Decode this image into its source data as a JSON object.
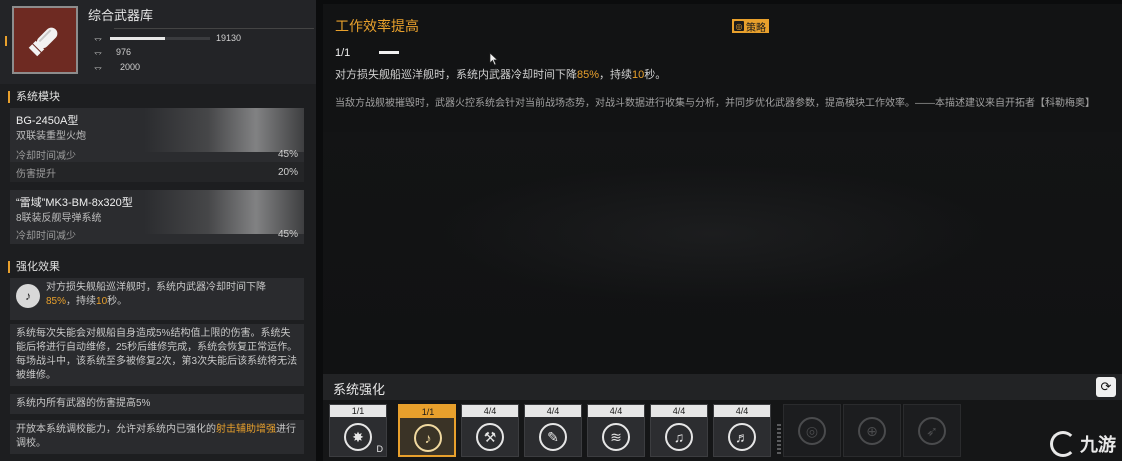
{
  "weapon": {
    "name": "综合武器库",
    "stats": [
      {
        "icon": "damage-icon",
        "value": "19130",
        "fill": 0.55
      },
      {
        "icon": "armor-icon",
        "value": "976",
        "fill": 0.03
      },
      {
        "icon": "speed-icon",
        "value": "2000",
        "fill": 0.05
      }
    ]
  },
  "modules_section": {
    "title": "系统模块",
    "modules": [
      {
        "name": "BG-2450A型",
        "subtitle": "双联装重型火炮",
        "rows": [
          {
            "label": "冷却时间减少",
            "value": "45%"
          },
          {
            "label": "伤害提升",
            "value": "20%"
          }
        ]
      },
      {
        "name": "“雷域”MK3-BM-8x320型",
        "subtitle": "8联装反舰导弹系统",
        "rows": [
          {
            "label": "冷却时间减少",
            "value": "45%"
          }
        ]
      }
    ]
  },
  "effects_section": {
    "title": "强化效果",
    "effect1_a": "对方损失舰船巡洋舰时，系统内武器冷却时间下降",
    "effect1_hl": "85%",
    "effect1_b": "，持续",
    "effect1_hl2": "10",
    "effect1_c": "秒。",
    "effect2": "系统每次失能会对舰船自身造成5%结构值上限的伤害。系统失能后将进行自动维修，25秒后维修完成，系统会恢复正常运作。每场战斗中，该系统至多被修复2次，第3次失能后该系统将无法被维修。",
    "effect3": "系统内所有武器的伤害提高5%",
    "effect4_a": "开放本系统调校能力，允许对系统内已强化的",
    "effect4_hl": "射击辅助增强",
    "effect4_b": "进行调校。"
  },
  "detail": {
    "title": "工作效率提高",
    "tag": "策略",
    "level": "1/1",
    "desc_a": "对方损失舰船巡洋舰时，系统内武器冷却时间下降",
    "desc_hl": "85%",
    "desc_b": "，持续",
    "desc_hl2": "10",
    "desc_c": "秒。",
    "flavor": "当敌方战舰被摧毁时，武器火控系统会针对当前战场态势，对战斗数据进行收集与分析，并同步优化武器参数，提高模块工作效率。——本描述建议来自开拓者【科勒梅奥】"
  },
  "enhancement": {
    "title": "系统强化",
    "slots": [
      {
        "count": "1/1",
        "icon": "efficiency-icon",
        "state": "normal",
        "suffix": "D"
      },
      {
        "count": "1/1",
        "icon": "guitar-upgrade-icon",
        "state": "selected",
        "suffix": ""
      },
      {
        "count": "4/4",
        "icon": "hammer-icon",
        "state": "normal",
        "suffix": ""
      },
      {
        "count": "4/4",
        "icon": "wrench-icon",
        "state": "normal",
        "suffix": ""
      },
      {
        "count": "4/4",
        "icon": "heat-icon",
        "state": "normal",
        "suffix": ""
      },
      {
        "count": "4/4",
        "icon": "guitar-icon",
        "state": "normal",
        "suffix": ""
      },
      {
        "count": "4/4",
        "icon": "guitar-alt-icon",
        "state": "normal",
        "suffix": ""
      },
      {
        "count": "",
        "icon": "locked-radar-icon",
        "state": "locked",
        "suffix": ""
      },
      {
        "count": "",
        "icon": "locked-target-icon",
        "state": "locked",
        "suffix": ""
      },
      {
        "count": "",
        "icon": "locked-missile-icon",
        "state": "locked",
        "suffix": ""
      }
    ]
  },
  "watermark": "九游",
  "colors": {
    "accent": "#e8a02c",
    "weapon_bg": "#6e2a22"
  }
}
